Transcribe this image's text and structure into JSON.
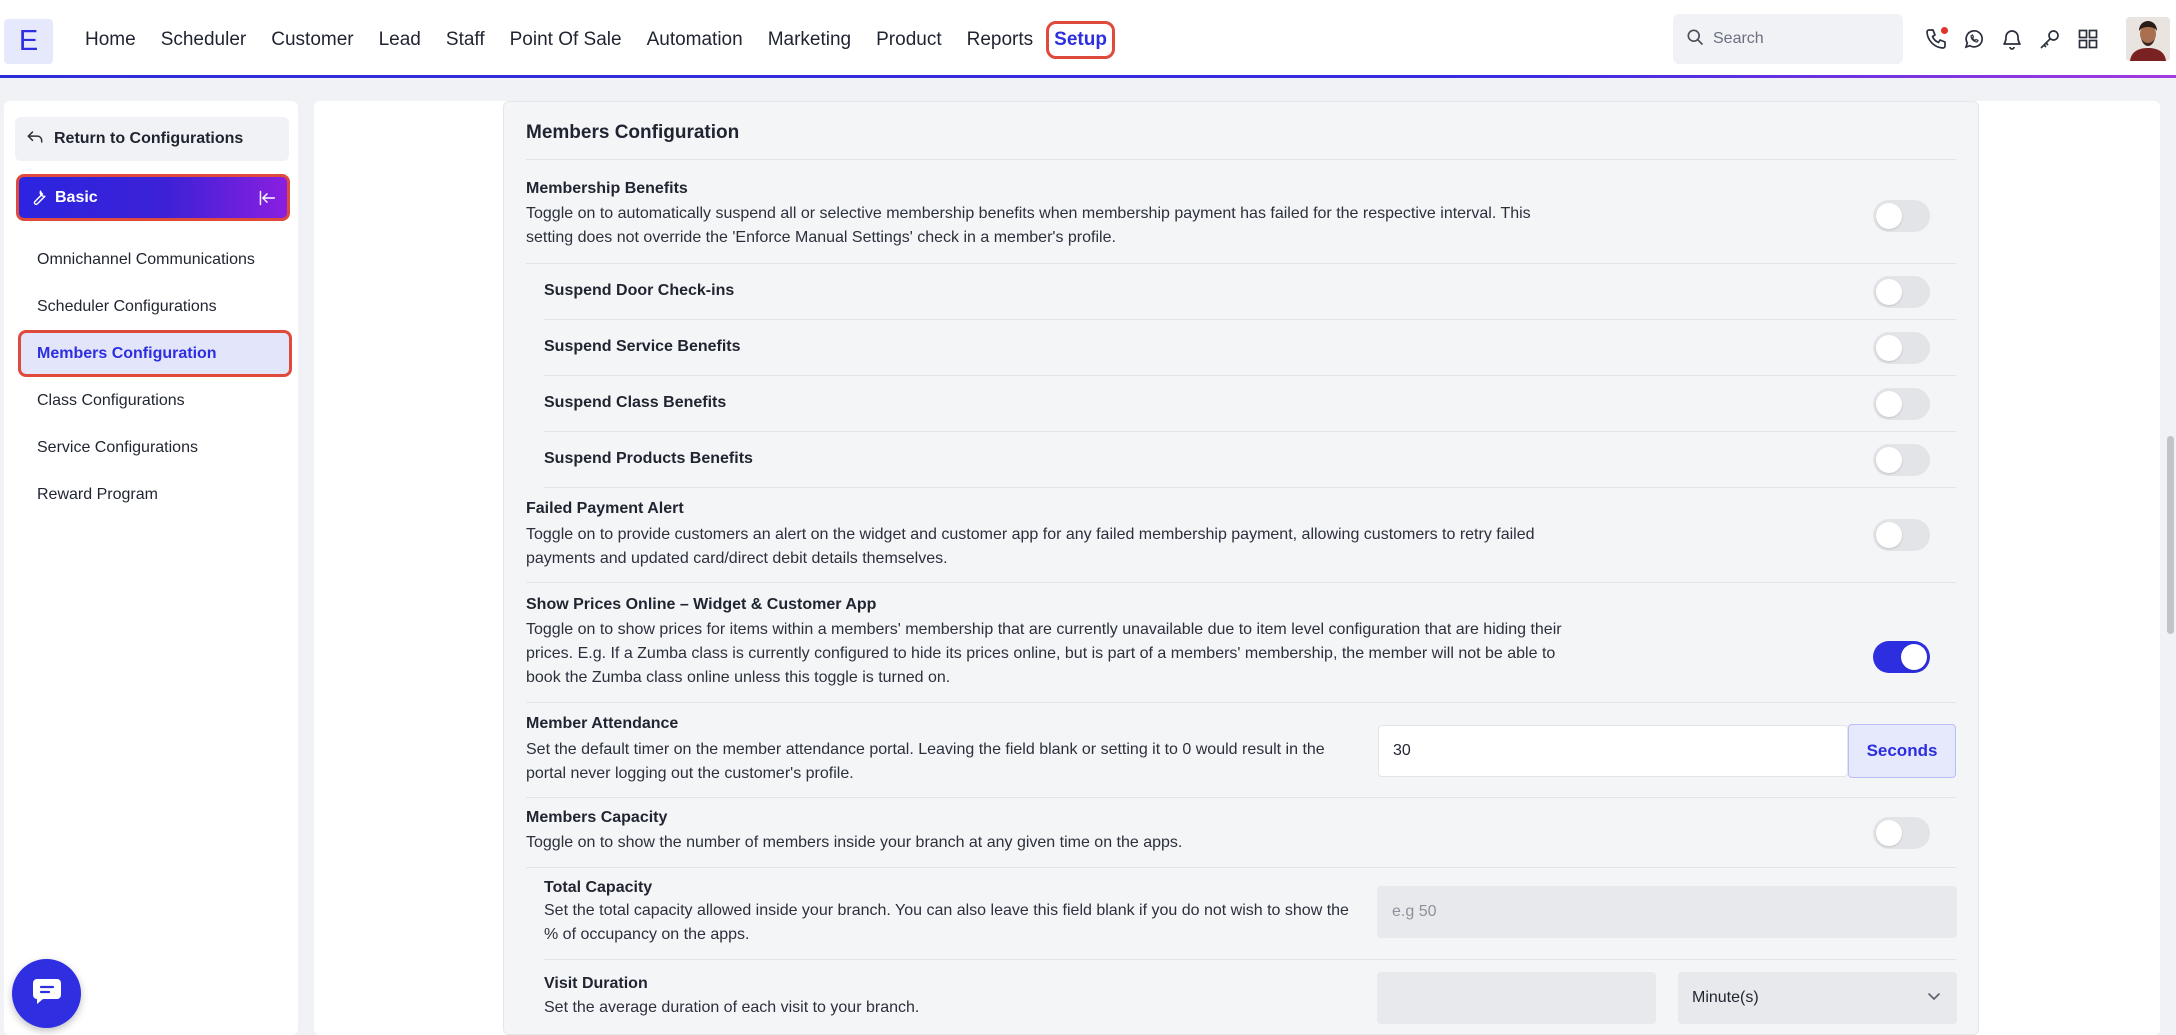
{
  "logo": "E",
  "nav": {
    "items": [
      "Home",
      "Scheduler",
      "Customer",
      "Lead",
      "Staff",
      "Point Of Sale",
      "Automation",
      "Marketing",
      "Product",
      "Reports",
      "Setup"
    ],
    "active": "Setup"
  },
  "search": {
    "placeholder": "Search"
  },
  "top_icons": [
    "phone-icon",
    "whatsapp-icon",
    "bell-icon",
    "key-icon",
    "apps-grid-icon"
  ],
  "colors": {
    "accent": "#2c2ee0",
    "highlight": "#e04a3c",
    "toggle_off": "#e3e4e8"
  },
  "sidebar": {
    "back_label": "Return to Configurations",
    "section_label": "Basic",
    "items": [
      {
        "label": "Omnichannel Communications",
        "active": false
      },
      {
        "label": "Scheduler Configurations",
        "active": false
      },
      {
        "label": "Members Configuration",
        "active": true
      },
      {
        "label": "Class Configurations",
        "active": false
      },
      {
        "label": "Service Configurations",
        "active": false
      },
      {
        "label": "Reward Program",
        "active": false
      }
    ]
  },
  "panel": {
    "title": "Members Configuration",
    "membership_benefits": {
      "title": "Membership Benefits",
      "desc_line1": "Toggle on to automatically suspend all or selective membership benefits when membership payment has failed for the respective interval. This",
      "desc_line2": "setting does not override the 'Enforce Manual Settings' check in a member's profile.",
      "enabled": false
    },
    "suspend_door": {
      "title": "Suspend Door Check-ins",
      "enabled": false
    },
    "suspend_service": {
      "title": "Suspend Service Benefits",
      "enabled": false
    },
    "suspend_class": {
      "title": "Suspend Class Benefits",
      "enabled": false
    },
    "suspend_products": {
      "title": "Suspend Products Benefits",
      "enabled": false
    },
    "failed_payment": {
      "title": "Failed Payment Alert",
      "desc_line1": "Toggle on to provide customers an alert on the widget and customer app for any failed membership payment, allowing customers to retry failed",
      "desc_line2": "payments and updated card/direct debit details themselves.",
      "enabled": false
    },
    "show_prices": {
      "title": "Show Prices Online – Widget & Customer App",
      "desc_line1": "Toggle on to show prices for items within a members' membership that are currently unavailable due to item level configuration that are hiding their",
      "desc_line2": "prices. E.g. If a Zumba class is currently configured to hide its prices online, but is part of a members' membership, the member will not be able to",
      "desc_line3": "book the Zumba class online unless this toggle is turned on.",
      "enabled": true
    },
    "member_attendance": {
      "title": "Member Attendance",
      "desc_line1": "Set the default timer on the member attendance portal. Leaving the field blank or setting it to 0 would result in the",
      "desc_line2": "portal never logging out the customer's profile.",
      "value": "30",
      "unit": "Seconds"
    },
    "members_capacity": {
      "title": "Members Capacity",
      "desc_line1": "Toggle on to show the number of members inside your branch at any given time on the apps.",
      "enabled": false
    },
    "total_capacity": {
      "title": "Total Capacity",
      "desc_line1": "Set the total capacity allowed inside your branch. You can also leave this field blank if you do not wish to show the",
      "desc_line2": "% of occupancy on the apps.",
      "placeholder": "e.g 50"
    },
    "visit_duration": {
      "title": "Visit Duration",
      "desc_line1": "Set the average duration of each visit to your branch.",
      "value": "",
      "unit_selected": "Minute(s)"
    }
  }
}
